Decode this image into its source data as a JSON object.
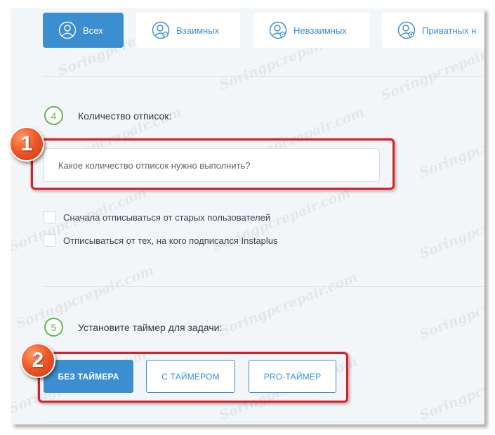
{
  "tabs": [
    {
      "label": "Всех",
      "icon": "user-circle-icon",
      "active": true
    },
    {
      "label": "Взаимных",
      "icon": "user-minus-icon",
      "active": false
    },
    {
      "label": "Невзаимных",
      "icon": "user-minus-icon",
      "active": false
    },
    {
      "label": "Приватных н",
      "icon": "user-plus-icon",
      "active": false
    }
  ],
  "step4": {
    "number": "4",
    "title": "Количество отписок:",
    "input_placeholder": "Какое количество отписок нужно выполнить?",
    "input_value": ""
  },
  "checkboxes": [
    {
      "label": "Сначала отписываться от старых пользователей",
      "checked": false
    },
    {
      "label": "Отписываться от тех, на кого подписался Instaplus",
      "checked": false
    }
  ],
  "step5": {
    "number": "5",
    "title": "Установите таймер для задачи:",
    "buttons": [
      {
        "label": "БЕЗ ТАЙМЕРА",
        "active": true
      },
      {
        "label": "С ТАЙМЕРОМ",
        "active": false
      },
      {
        "label": "PRO-ТАЙМЕР",
        "active": false
      }
    ]
  },
  "annotations": [
    "1",
    "2"
  ],
  "watermark": "Soringpcrepair.com",
  "colors": {
    "accent": "#3b8fd0",
    "step_green": "#5fb94a",
    "annotation_red": "#d2232a",
    "marker_orange": "#f05a28"
  }
}
